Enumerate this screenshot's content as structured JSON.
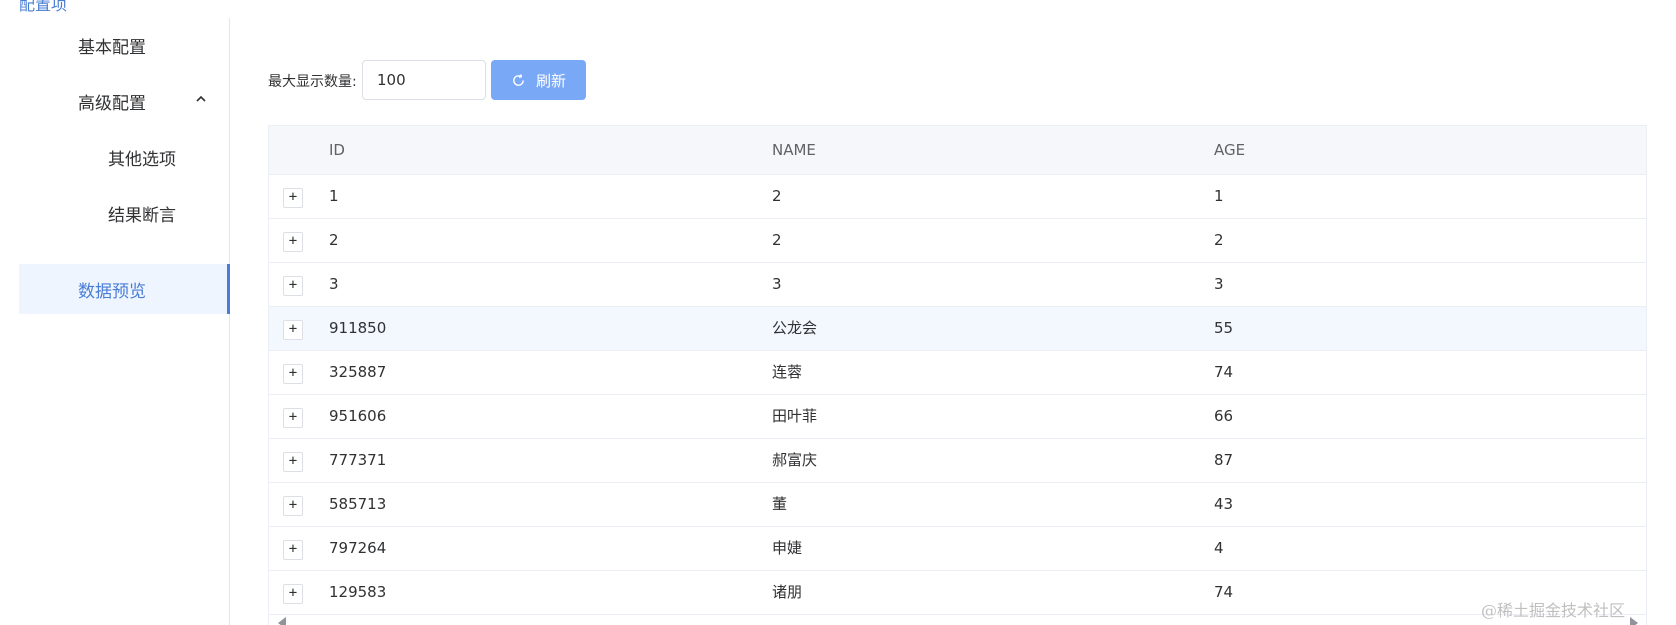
{
  "breadcrumb": "配置项",
  "sidebar": {
    "items": [
      {
        "label": "基本配置"
      },
      {
        "label": "高级配置"
      },
      {
        "label": "其他选项"
      },
      {
        "label": "结果断言"
      },
      {
        "label": "数据预览"
      }
    ],
    "active": "数据预览"
  },
  "toolbar": {
    "max_label": "最大显示数量:",
    "max_value": "100",
    "refresh_label": "刷新"
  },
  "table": {
    "headers": [
      "ID",
      "NAME",
      "AGE"
    ],
    "expand_symbol": "+",
    "rows": [
      {
        "id": "1",
        "name": "2",
        "age": "1"
      },
      {
        "id": "2",
        "name": "2",
        "age": "2"
      },
      {
        "id": "3",
        "name": "3",
        "age": "3"
      },
      {
        "id": "911850",
        "name": "公龙会",
        "age": "55"
      },
      {
        "id": "325887",
        "name": "连蓉",
        "age": "74"
      },
      {
        "id": "951606",
        "name": "田叶菲",
        "age": "66"
      },
      {
        "id": "777371",
        "name": "郝富庆",
        "age": "87"
      },
      {
        "id": "585713",
        "name": "董",
        "age": "43"
      },
      {
        "id": "797264",
        "name": "申婕",
        "age": "4"
      },
      {
        "id": "129583",
        "name": "诸朋",
        "age": "74"
      }
    ]
  },
  "watermark": "@稀土掘金技术社区",
  "colors": {
    "accent": "#4a7dd6",
    "button": "#79a8f7",
    "header_bg": "#f5f7fa",
    "hover_row": "#f3f8ff"
  }
}
